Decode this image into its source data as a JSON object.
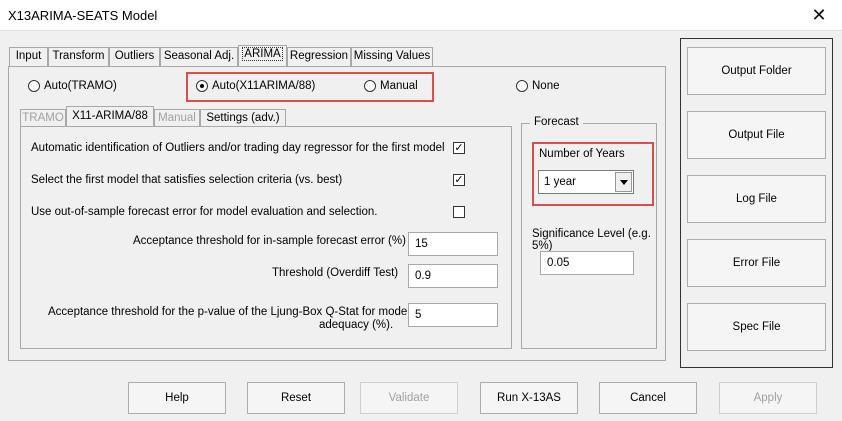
{
  "window": {
    "title": "X13ARIMA-SEATS Model"
  },
  "tabs": [
    {
      "label": "Input"
    },
    {
      "label": "Transform"
    },
    {
      "label": "Outliers"
    },
    {
      "label": "Seasonal Adj."
    },
    {
      "label": "ARIMA"
    },
    {
      "label": "Regression"
    },
    {
      "label": "Missing Values"
    }
  ],
  "arima": {
    "mode_options": [
      {
        "label": "Auto(TRAMO)",
        "selected": false
      },
      {
        "label": "Auto(X11ARIMA/88)",
        "selected": true
      },
      {
        "label": "Manual",
        "selected": false
      },
      {
        "label": "None",
        "selected": false
      }
    ],
    "subtabs": [
      {
        "label": "TRAMO",
        "disabled": true
      },
      {
        "label": "X11-ARIMA/88",
        "disabled": false
      },
      {
        "label": "Manual",
        "disabled": true
      },
      {
        "label": "Settings (adv.)",
        "disabled": false
      }
    ],
    "x11": {
      "checks": [
        {
          "label": "Automatic identification of Outliers and/or trading day regressor for the first model",
          "checked": true
        },
        {
          "label": "Select the first model that satisfies selection criteria (vs. best)",
          "checked": true
        },
        {
          "label": "Use out-of-sample forecast error for model evaluation and selection.",
          "checked": false
        }
      ],
      "fields": [
        {
          "label": "Acceptance threshold for in-sample forecast error (%)",
          "value": "15"
        },
        {
          "label": "Threshold (Overdiff Test)",
          "value": "0.9"
        },
        {
          "label_line1": "Acceptance threshold for the p-value of the Ljung-Box Q-Stat for model",
          "label_line2": "adequacy (%).",
          "value": "5"
        }
      ]
    },
    "forecast": {
      "legend": "Forecast",
      "years_label": "Number of Years",
      "years_value": "1 year",
      "significance_label_line1": "Significance Level (e.g.",
      "significance_label_line2": "5%)",
      "significance_value": "0.05"
    }
  },
  "side_buttons": [
    {
      "label": "Output Folder"
    },
    {
      "label": "Output File"
    },
    {
      "label": "Log File"
    },
    {
      "label": "Error File"
    },
    {
      "label": "Spec File"
    }
  ],
  "bottom_buttons": [
    {
      "label": "Help",
      "disabled": false
    },
    {
      "label": "Reset",
      "disabled": false
    },
    {
      "label": "Validate",
      "disabled": true
    },
    {
      "label": "Run X-13AS",
      "disabled": false
    },
    {
      "label": "Cancel",
      "disabled": false
    },
    {
      "label": "Apply",
      "disabled": true
    }
  ],
  "colors": {
    "highlight": "#e04b4b",
    "disabled_text": "#a0a0a0"
  },
  "icons": {
    "close": "close-icon",
    "dropdown": "chevron-down-icon"
  }
}
